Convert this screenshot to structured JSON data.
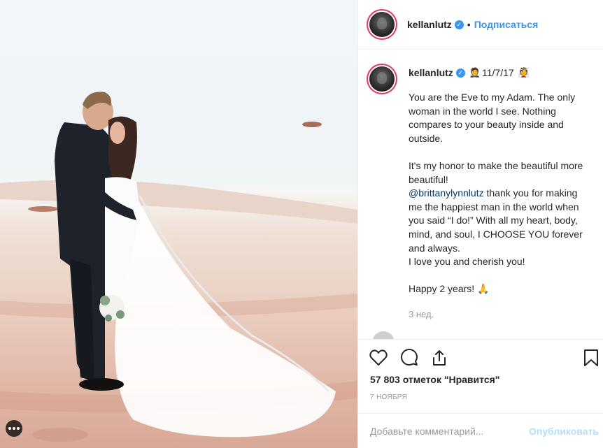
{
  "post": {
    "media_alt": "Photo by kellanlutz",
    "media_indicator_icon": "more-media-dots-icon"
  },
  "header": {
    "username": "kellanlutz",
    "verified_icon": "verified-badge-icon",
    "separator": "•",
    "follow_label": "Подписаться"
  },
  "caption": {
    "username": "kellanlutz",
    "emoji_groom": "🤵",
    "date_text": "11/7/17",
    "emoji_bride": "👰",
    "text": "You are the Eve to my Adam. The only woman in the world I see. Nothing compares to your beauty inside and outside.\n\nIt's my honor to make the beautiful more beautiful!\n",
    "mention": "@brittanylynnlutz",
    "text_after": " thank you for making me the happiest man in the world when you said “I do!” With all my heart, body, mind, and soul, I CHOOSE YOU forever and always.\nI love you and cherish you!\n\nHappy 2 years! 🙏",
    "time_ago": "3 нед."
  },
  "actions": {
    "like_icon": "heart-icon",
    "comment_icon": "comment-icon",
    "share_icon": "share-icon",
    "save_icon": "bookmark-icon"
  },
  "likes_text": "57 803 отметок \"Нравится\"",
  "post_date": "7 НОЯБРЯ",
  "comment_box": {
    "placeholder": "Добавьте комментарий...",
    "publish_label": "Опубликовать"
  },
  "colors": {
    "accent": "#3897f0",
    "publish_disabled": "#b2dffc",
    "story_ring": "#e13b62",
    "muted": "#999999"
  }
}
